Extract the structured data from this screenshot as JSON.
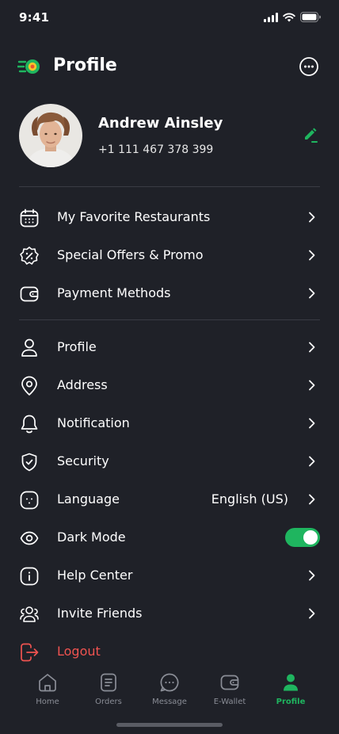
{
  "status_bar": {
    "time": "9:41"
  },
  "header": {
    "title": "Profile"
  },
  "user": {
    "name": "Andrew Ainsley",
    "phone": "+1 111 467 378 399"
  },
  "menu_group_1": [
    {
      "label": "My Favorite Restaurants",
      "icon": "calendar-icon"
    },
    {
      "label": "Special Offers & Promo",
      "icon": "discount-badge-icon"
    },
    {
      "label": "Payment Methods",
      "icon": "wallet-icon"
    }
  ],
  "menu_group_2": [
    {
      "label": "Profile",
      "icon": "user-icon"
    },
    {
      "label": "Address",
      "icon": "location-pin-icon"
    },
    {
      "label": "Notification",
      "icon": "bell-icon"
    },
    {
      "label": "Security",
      "icon": "shield-check-icon"
    },
    {
      "label": "Language",
      "icon": "language-icon",
      "value": "English (US)"
    },
    {
      "label": "Dark Mode",
      "icon": "eye-icon",
      "toggle_on": true
    },
    {
      "label": "Help Center",
      "icon": "info-icon"
    },
    {
      "label": "Invite Friends",
      "icon": "users-icon"
    },
    {
      "label": "Logout",
      "icon": "logout-icon"
    }
  ],
  "tabbar": {
    "items": [
      {
        "label": "Home",
        "icon": "home-icon"
      },
      {
        "label": "Orders",
        "icon": "orders-icon"
      },
      {
        "label": "Message",
        "icon": "message-icon"
      },
      {
        "label": "E-Wallet",
        "icon": "wallet-icon"
      },
      {
        "label": "Profile",
        "icon": "user-icon",
        "active": true
      }
    ]
  },
  "colors": {
    "background": "#1f2128",
    "accent": "#1fb55f",
    "danger": "#ef5350",
    "divider": "#3a3c44"
  }
}
